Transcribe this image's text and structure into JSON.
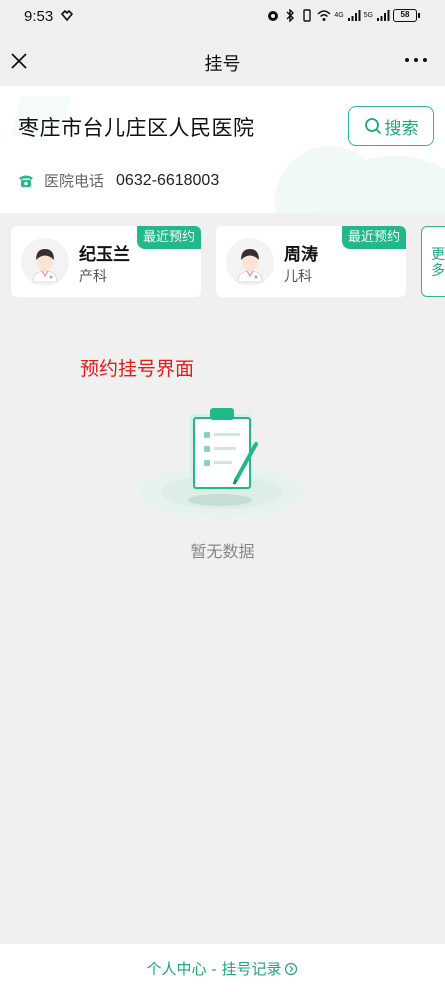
{
  "status_bar": {
    "time": "9:53",
    "network_1": "4G",
    "network_2": "5G",
    "battery": "58"
  },
  "title_bar": {
    "title": "挂号",
    "close_icon": "close-icon",
    "more_icon": "more-icon"
  },
  "hospital": {
    "name": "枣庄市台儿庄区人民医院",
    "search_label": "搜索",
    "phone_label": "医院电话",
    "phone_number": "0632-6618003"
  },
  "doctors": [
    {
      "name": "纪玉兰",
      "department": "产科",
      "badge": "最近预约"
    },
    {
      "name": "周涛",
      "department": "儿科",
      "badge": "最近预约"
    }
  ],
  "more_label": "更多",
  "overlay_label": "预约挂号界面",
  "empty_state": {
    "text": "暂无数据"
  },
  "footer": {
    "link_label": "个人中心 - 挂号记录"
  },
  "colors": {
    "accent": "#22b889",
    "overlay": "#e41b17"
  }
}
